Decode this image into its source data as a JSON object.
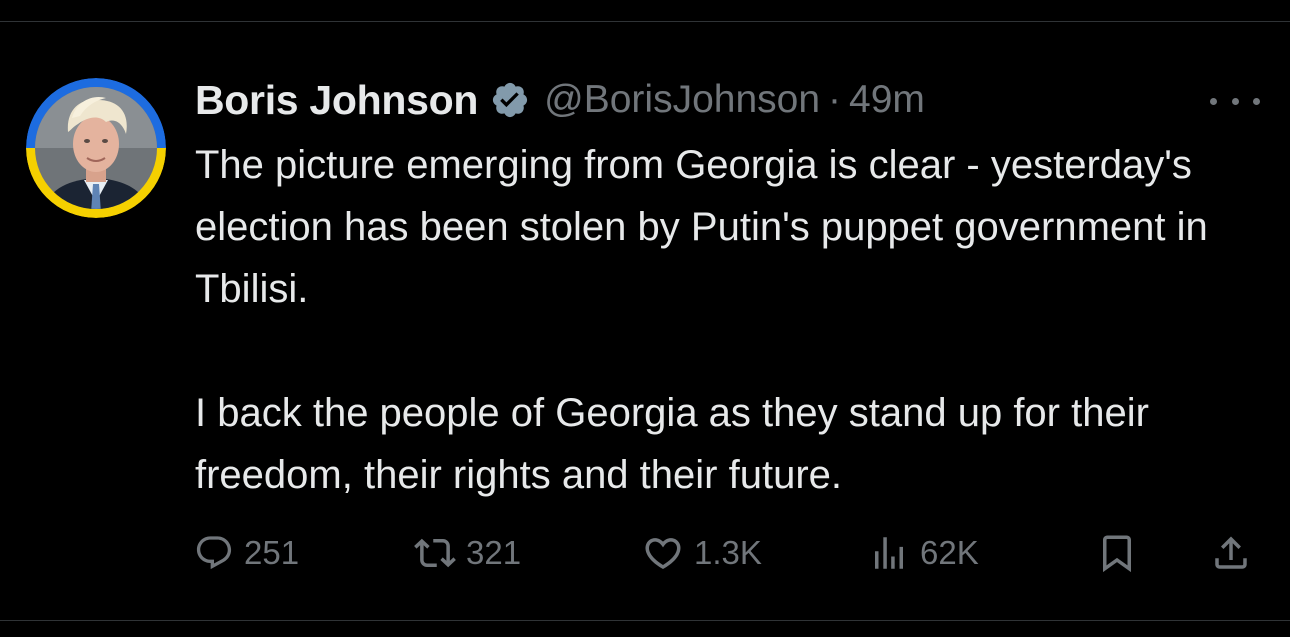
{
  "colors": {
    "background": "#000000",
    "text": "#e7e9ea",
    "muted": "#71767b",
    "verified_badge": "#829aab",
    "avatar_ring_top": "#1d6ce0",
    "avatar_ring_bottom": "#f5d000"
  },
  "tweet": {
    "display_name": "Boris Johnson",
    "verified_icon": "verified-badge-icon",
    "handle": "@BorisJohnson",
    "separator": "·",
    "time": "49m",
    "more_icon": "more-options-icon",
    "text_paragraphs": [
      "The picture emerging from Georgia is clear - yesterday's election has been stolen by Putin's puppet government in Tbilisi.",
      "I back the people of Georgia as they stand up for their freedom, their rights and their future."
    ]
  },
  "actions": {
    "reply": {
      "icon": "reply-icon",
      "count": "251"
    },
    "retweet": {
      "icon": "retweet-icon",
      "count": "321"
    },
    "like": {
      "icon": "like-icon",
      "count": "1.3K"
    },
    "views": {
      "icon": "views-icon",
      "count": "62K"
    },
    "bookmark": {
      "icon": "bookmark-icon"
    },
    "share": {
      "icon": "share-icon"
    }
  }
}
